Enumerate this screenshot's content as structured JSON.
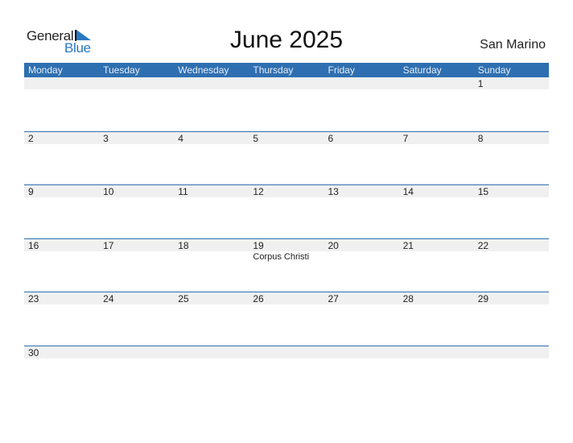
{
  "logo": {
    "word1": "General",
    "word2": "Blue",
    "accent_color": "#2a78c2"
  },
  "header": {
    "title": "June 2025",
    "country": "San Marino"
  },
  "colors": {
    "header_bar": "#2e6fb1",
    "date_band": "#f0f0f0"
  },
  "weekdays": [
    "Monday",
    "Tuesday",
    "Wednesday",
    "Thursday",
    "Friday",
    "Saturday",
    "Sunday"
  ],
  "weeks": [
    [
      {
        "day": ""
      },
      {
        "day": ""
      },
      {
        "day": ""
      },
      {
        "day": ""
      },
      {
        "day": ""
      },
      {
        "day": ""
      },
      {
        "day": "1"
      }
    ],
    [
      {
        "day": "2"
      },
      {
        "day": "3"
      },
      {
        "day": "4"
      },
      {
        "day": "5"
      },
      {
        "day": "6"
      },
      {
        "day": "7"
      },
      {
        "day": "8"
      }
    ],
    [
      {
        "day": "9"
      },
      {
        "day": "10"
      },
      {
        "day": "11"
      },
      {
        "day": "12"
      },
      {
        "day": "13"
      },
      {
        "day": "14"
      },
      {
        "day": "15"
      }
    ],
    [
      {
        "day": "16"
      },
      {
        "day": "17"
      },
      {
        "day": "18"
      },
      {
        "day": "19",
        "event": "Corpus Christi"
      },
      {
        "day": "20"
      },
      {
        "day": "21"
      },
      {
        "day": "22"
      }
    ],
    [
      {
        "day": "23"
      },
      {
        "day": "24"
      },
      {
        "day": "25"
      },
      {
        "day": "26"
      },
      {
        "day": "27"
      },
      {
        "day": "28"
      },
      {
        "day": "29"
      }
    ],
    [
      {
        "day": "30"
      },
      {
        "day": ""
      },
      {
        "day": ""
      },
      {
        "day": ""
      },
      {
        "day": ""
      },
      {
        "day": ""
      },
      {
        "day": ""
      }
    ]
  ]
}
